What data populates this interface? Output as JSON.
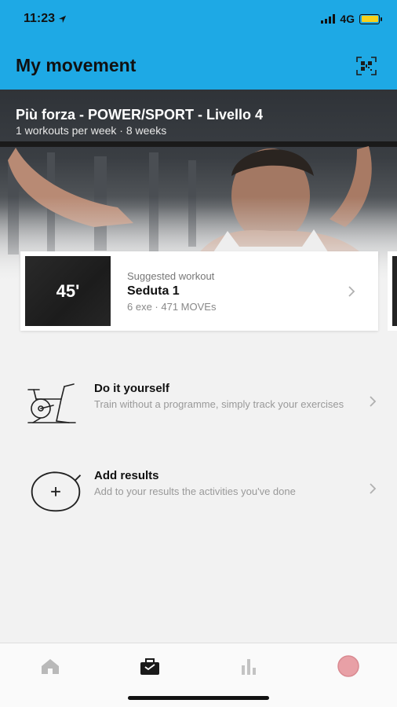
{
  "status_bar": {
    "time": "11:23",
    "network": "4G"
  },
  "header": {
    "title": "My movement",
    "scan_icon": "qr-scan-icon"
  },
  "hero": {
    "title": "Più forza - POWER/SPORT - Livello 4",
    "subtitle": "1 workouts per week · 8 weeks"
  },
  "workout_card": {
    "duration": "45'",
    "label": "Suggested workout",
    "title": "Seduta 1",
    "meta": "6 exe · 471 MOVEs"
  },
  "actions": [
    {
      "title": "Do it yourself",
      "description": "Train without a programme, simply track your exercises",
      "icon": "exercise-bike-icon"
    },
    {
      "title": "Add results",
      "description": "Add to your results the activities you've done",
      "icon": "add-results-icon"
    }
  ],
  "tabs": [
    {
      "name": "home",
      "icon": "home-icon",
      "active": false
    },
    {
      "name": "my-movement",
      "icon": "bag-icon",
      "active": true
    },
    {
      "name": "stats",
      "icon": "bar-chart-icon",
      "active": false
    },
    {
      "name": "profile",
      "icon": "avatar-icon",
      "active": false
    }
  ],
  "colors": {
    "header": "#1ea9e5",
    "battery": "#f7d21b",
    "avatar": "#e8a0a6"
  }
}
